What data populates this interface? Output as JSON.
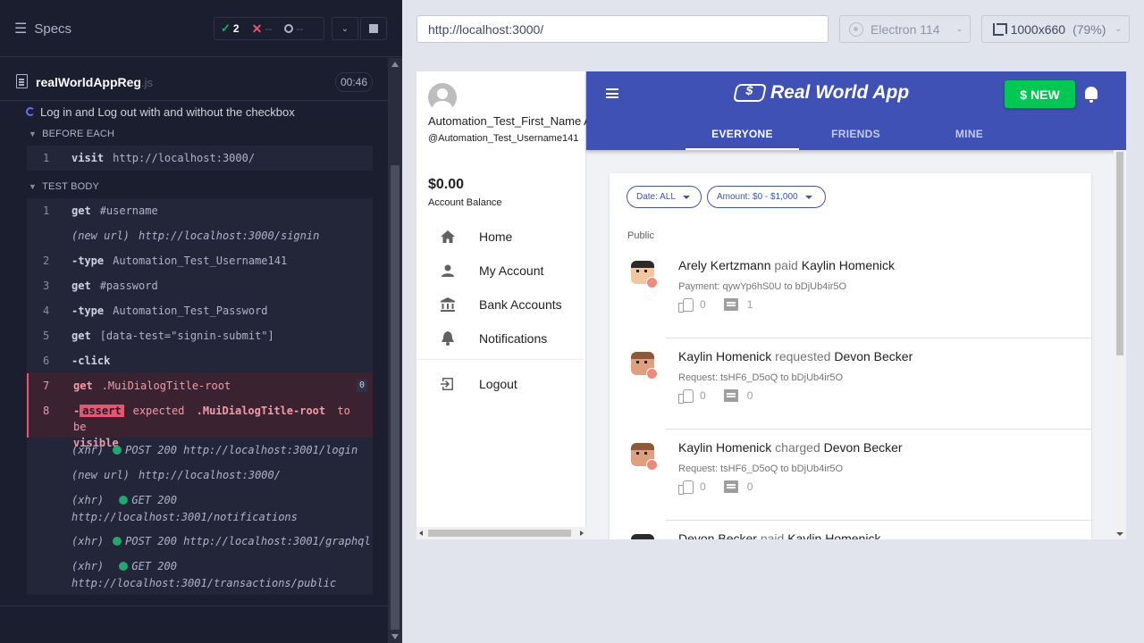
{
  "reporter": {
    "specs_label": "Specs",
    "passed": "2",
    "failed": "--",
    "pending": "--",
    "file_name": "realWorldAppReg",
    "file_ext": ".js",
    "duration": "00:46",
    "test_title": "Log in and Log out with and without the checkbox",
    "before_each_label": "BEFORE EACH",
    "test_body_label": "TEST BODY",
    "before_each": [
      {
        "num": "1",
        "name": "visit",
        "msg": "http://localhost:3000/"
      }
    ],
    "body": [
      {
        "num": "1",
        "name": "get",
        "msg": "#username"
      },
      {
        "event": "(new url)",
        "msg": "http://localhost:3000/signin"
      },
      {
        "num": "2",
        "name": "-type",
        "msg": "Automation_Test_Username141"
      },
      {
        "num": "3",
        "name": "get",
        "msg": "#password"
      },
      {
        "num": "4",
        "name": "-type",
        "msg": "Automation_Test_Password"
      },
      {
        "num": "5",
        "name": "get",
        "msg": "[data-test=\"signin-submit\"]"
      },
      {
        "num": "6",
        "name": "-click",
        "msg": ""
      },
      {
        "num": "7",
        "name": "get",
        "msg": ".MuiDialogTitle-root",
        "badge": "0"
      },
      {
        "num": "8",
        "dash": "-",
        "tag": "assert",
        "pre": "expected",
        "subject": ".MuiDialogTitle-root",
        "post": "to be",
        "last": "visible"
      },
      {
        "event": "(xhr)",
        "method": "POST 200",
        "url": "http://localhost:3001/login"
      },
      {
        "event": "(new url)",
        "msg": "http://localhost:3000/"
      },
      {
        "event": "(xhr)",
        "method": "GET 200",
        "url": "http://localhost:3001/notifications"
      },
      {
        "event": "(xhr)",
        "method": "POST 200",
        "url": "http://localhost:3001/graphql"
      },
      {
        "event": "(xhr)",
        "method": "GET 200",
        "url": "http://localhost:3001/transactions/public"
      }
    ]
  },
  "toolbar": {
    "url": "http://localhost:3000/",
    "browser": "Electron 114",
    "viewport": "1000x660",
    "scale": "(79%)"
  },
  "app": {
    "user_full_name": "Automation_Test_First_Name A",
    "user_handle": "@Automation_Test_Username141",
    "balance": "$0.00",
    "balance_label": "Account Balance",
    "nav": [
      {
        "label": "Home",
        "icon": "home-icon"
      },
      {
        "label": "My Account",
        "icon": "person-icon"
      },
      {
        "label": "Bank Accounts",
        "icon": "bank-icon"
      },
      {
        "label": "Notifications",
        "icon": "bell-icon"
      },
      {
        "label": "Logout",
        "icon": "logout-icon"
      }
    ],
    "title": "Real World App",
    "new_button": "NEW",
    "new_button_symbol": "$",
    "tabs": [
      "EVERYONE",
      "FRIENDS",
      "MINE"
    ],
    "filters": {
      "date": "Date: ALL",
      "amount": "Amount: $0 - $1,000"
    },
    "section_label": "Public",
    "transactions": [
      {
        "from": "Arely Kertzmann",
        "action": "paid",
        "to": "Kaylin Homenick",
        "detail": "Payment: qywYp6hS0U to bDjUb4ir5O",
        "likes": "0",
        "comments": "1"
      },
      {
        "from": "Kaylin Homenick",
        "action": "requested",
        "to": "Devon Becker",
        "detail": "Request: tsHF6_D5oQ to bDjUb4ir5O",
        "likes": "0",
        "comments": "0"
      },
      {
        "from": "Kaylin Homenick",
        "action": "charged",
        "to": "Devon Becker",
        "detail": "Request: tsHF6_D5oQ to bDjUb4ir5O",
        "likes": "0",
        "comments": "0"
      },
      {
        "from": "Devon Becker",
        "action": "paid",
        "to": "Kaylin Homenick",
        "detail": "",
        "likes": "",
        "comments": ""
      }
    ]
  },
  "colors": {
    "reporter_bg": "#1b1e2e",
    "pass": "#1fa971",
    "fail": "#e45770",
    "appbar": "#3f51b5",
    "new_button": "#00c853"
  }
}
